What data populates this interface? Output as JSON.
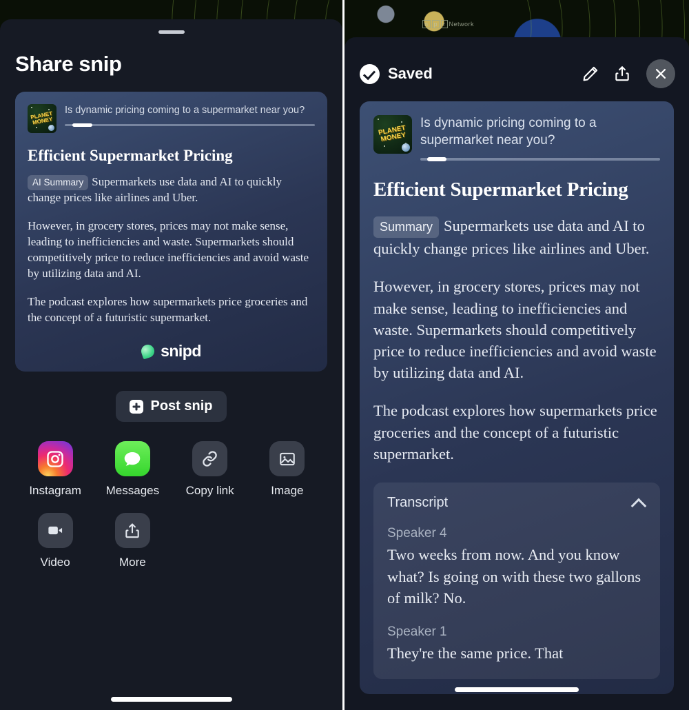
{
  "backdrop": {
    "npr_letters": [
      "n",
      "p",
      "r"
    ],
    "npr_network_label": "Network"
  },
  "episode": {
    "podcast_name_line1": "PLANET",
    "podcast_name_line2": "MONEY",
    "title": "Is dynamic pricing coming to a supermarket near you?",
    "progress_percent": 8
  },
  "snip": {
    "headline": "Efficient Supermarket Pricing",
    "badge_left": "AI Summary",
    "badge_right": "Summary",
    "paragraph1": "Supermarkets use data and AI to quickly change prices like airlines and Uber.",
    "paragraph2": "However, in grocery stores, prices may not make sense, leading to inefficiencies and waste. Supermarkets should competitively price to reduce inefficiencies and avoid waste by utilizing data and AI.",
    "paragraph3": "The podcast explores how supermarkets price groceries and the concept of a futuristic supermarket.",
    "brand": "snipd"
  },
  "share_sheet": {
    "title": "Share snip",
    "post_button_label": "Post snip",
    "targets": [
      {
        "label": "Instagram",
        "icon": "instagram-icon"
      },
      {
        "label": "Messages",
        "icon": "messages-icon"
      },
      {
        "label": "Copy link",
        "icon": "link-icon"
      },
      {
        "label": "Image",
        "icon": "image-icon"
      },
      {
        "label": "Video",
        "icon": "video-icon"
      },
      {
        "label": "More",
        "icon": "share-icon"
      }
    ]
  },
  "detail": {
    "status_label": "Saved",
    "actions": [
      {
        "name": "edit-button",
        "icon": "pencil-icon"
      },
      {
        "name": "share-button",
        "icon": "share-icon"
      },
      {
        "name": "close-button",
        "icon": "close-icon"
      }
    ],
    "transcript": {
      "title": "Transcript",
      "collapse_icon": "chevron-up-icon",
      "entries": [
        {
          "speaker": "Speaker 4",
          "text": "Two weeks from now. And you know what? Is going on with these two gallons of milk? No."
        },
        {
          "speaker": "Speaker 1",
          "text": "They're the same price. That"
        }
      ]
    }
  },
  "colors": {
    "sheet_bg": "#161a24",
    "detail_bg": "#131722",
    "card_top": "#3d5074",
    "card_bottom": "#222b45",
    "accent_green": "#3fd68a",
    "tile_plain": "#3a3f4b"
  }
}
